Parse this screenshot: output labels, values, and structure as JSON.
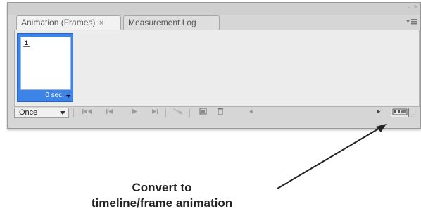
{
  "panel": {
    "tabs": [
      {
        "label": "Animation (Frames)",
        "close": "×",
        "active": true
      },
      {
        "label": "Measurement Log",
        "active": false
      }
    ],
    "window_controls": {
      "minimize": "-",
      "close": "×"
    },
    "menu_icon": "panel-menu-icon"
  },
  "frames": [
    {
      "number": "1",
      "delay": "0 sec."
    }
  ],
  "toolbar": {
    "loop": "Once",
    "icons": [
      "select-first-frame-icon",
      "select-previous-frame-icon",
      "play-icon",
      "select-next-frame-icon",
      "tween-icon",
      "duplicate-frame-icon",
      "delete-frame-icon",
      "convert-to-timeline-icon"
    ]
  },
  "annotation": {
    "line1": "Convert to",
    "line2": "timeline/frame animation"
  },
  "colors": {
    "frame_selected": "#3d84e8",
    "panel_bg": "#d6d6d6",
    "content_bg": "#ececec"
  }
}
